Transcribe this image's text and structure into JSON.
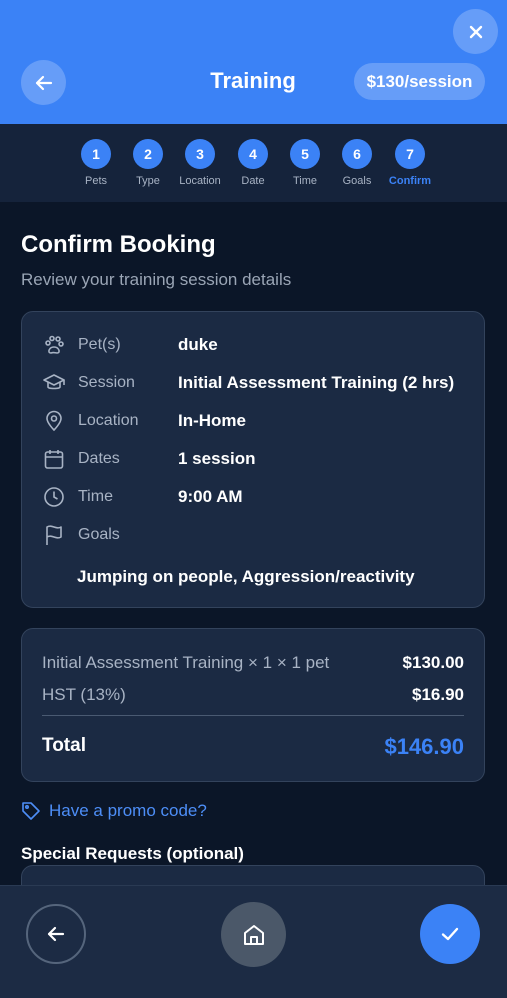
{
  "header": {
    "title": "Training",
    "price_badge": "$130/session"
  },
  "steps": [
    {
      "num": "1",
      "label": "Pets"
    },
    {
      "num": "2",
      "label": "Type"
    },
    {
      "num": "3",
      "label": "Location"
    },
    {
      "num": "4",
      "label": "Date"
    },
    {
      "num": "5",
      "label": "Time"
    },
    {
      "num": "6",
      "label": "Goals"
    },
    {
      "num": "7",
      "label": "Confirm"
    }
  ],
  "main": {
    "heading": "Confirm Booking",
    "subheading": "Review your training session details"
  },
  "details": {
    "pets_label": "Pet(s)",
    "pets_value": "duke",
    "session_label": "Session",
    "session_value": "Initial Assessment Training (2 hrs)",
    "location_label": "Location",
    "location_value": "In-Home",
    "dates_label": "Dates",
    "dates_value": "1 session",
    "time_label": "Time",
    "time_value": "9:00 AM",
    "goals_label": "Goals",
    "goals_value": "Jumping on people, Aggression/reactivity"
  },
  "pricing": {
    "line_label": "Initial Assessment Training × 1 × 1 pet",
    "line_value": "$130.00",
    "tax_label": "HST (13%)",
    "tax_value": "$16.90",
    "total_label": "Total",
    "total_value": "$146.90"
  },
  "promo_text": "Have a promo code?",
  "special_requests_label": "Special Requests (optional)",
  "colors": {
    "accent": "#3b82f6",
    "background": "#0b1628",
    "card": "#1b2a43"
  }
}
